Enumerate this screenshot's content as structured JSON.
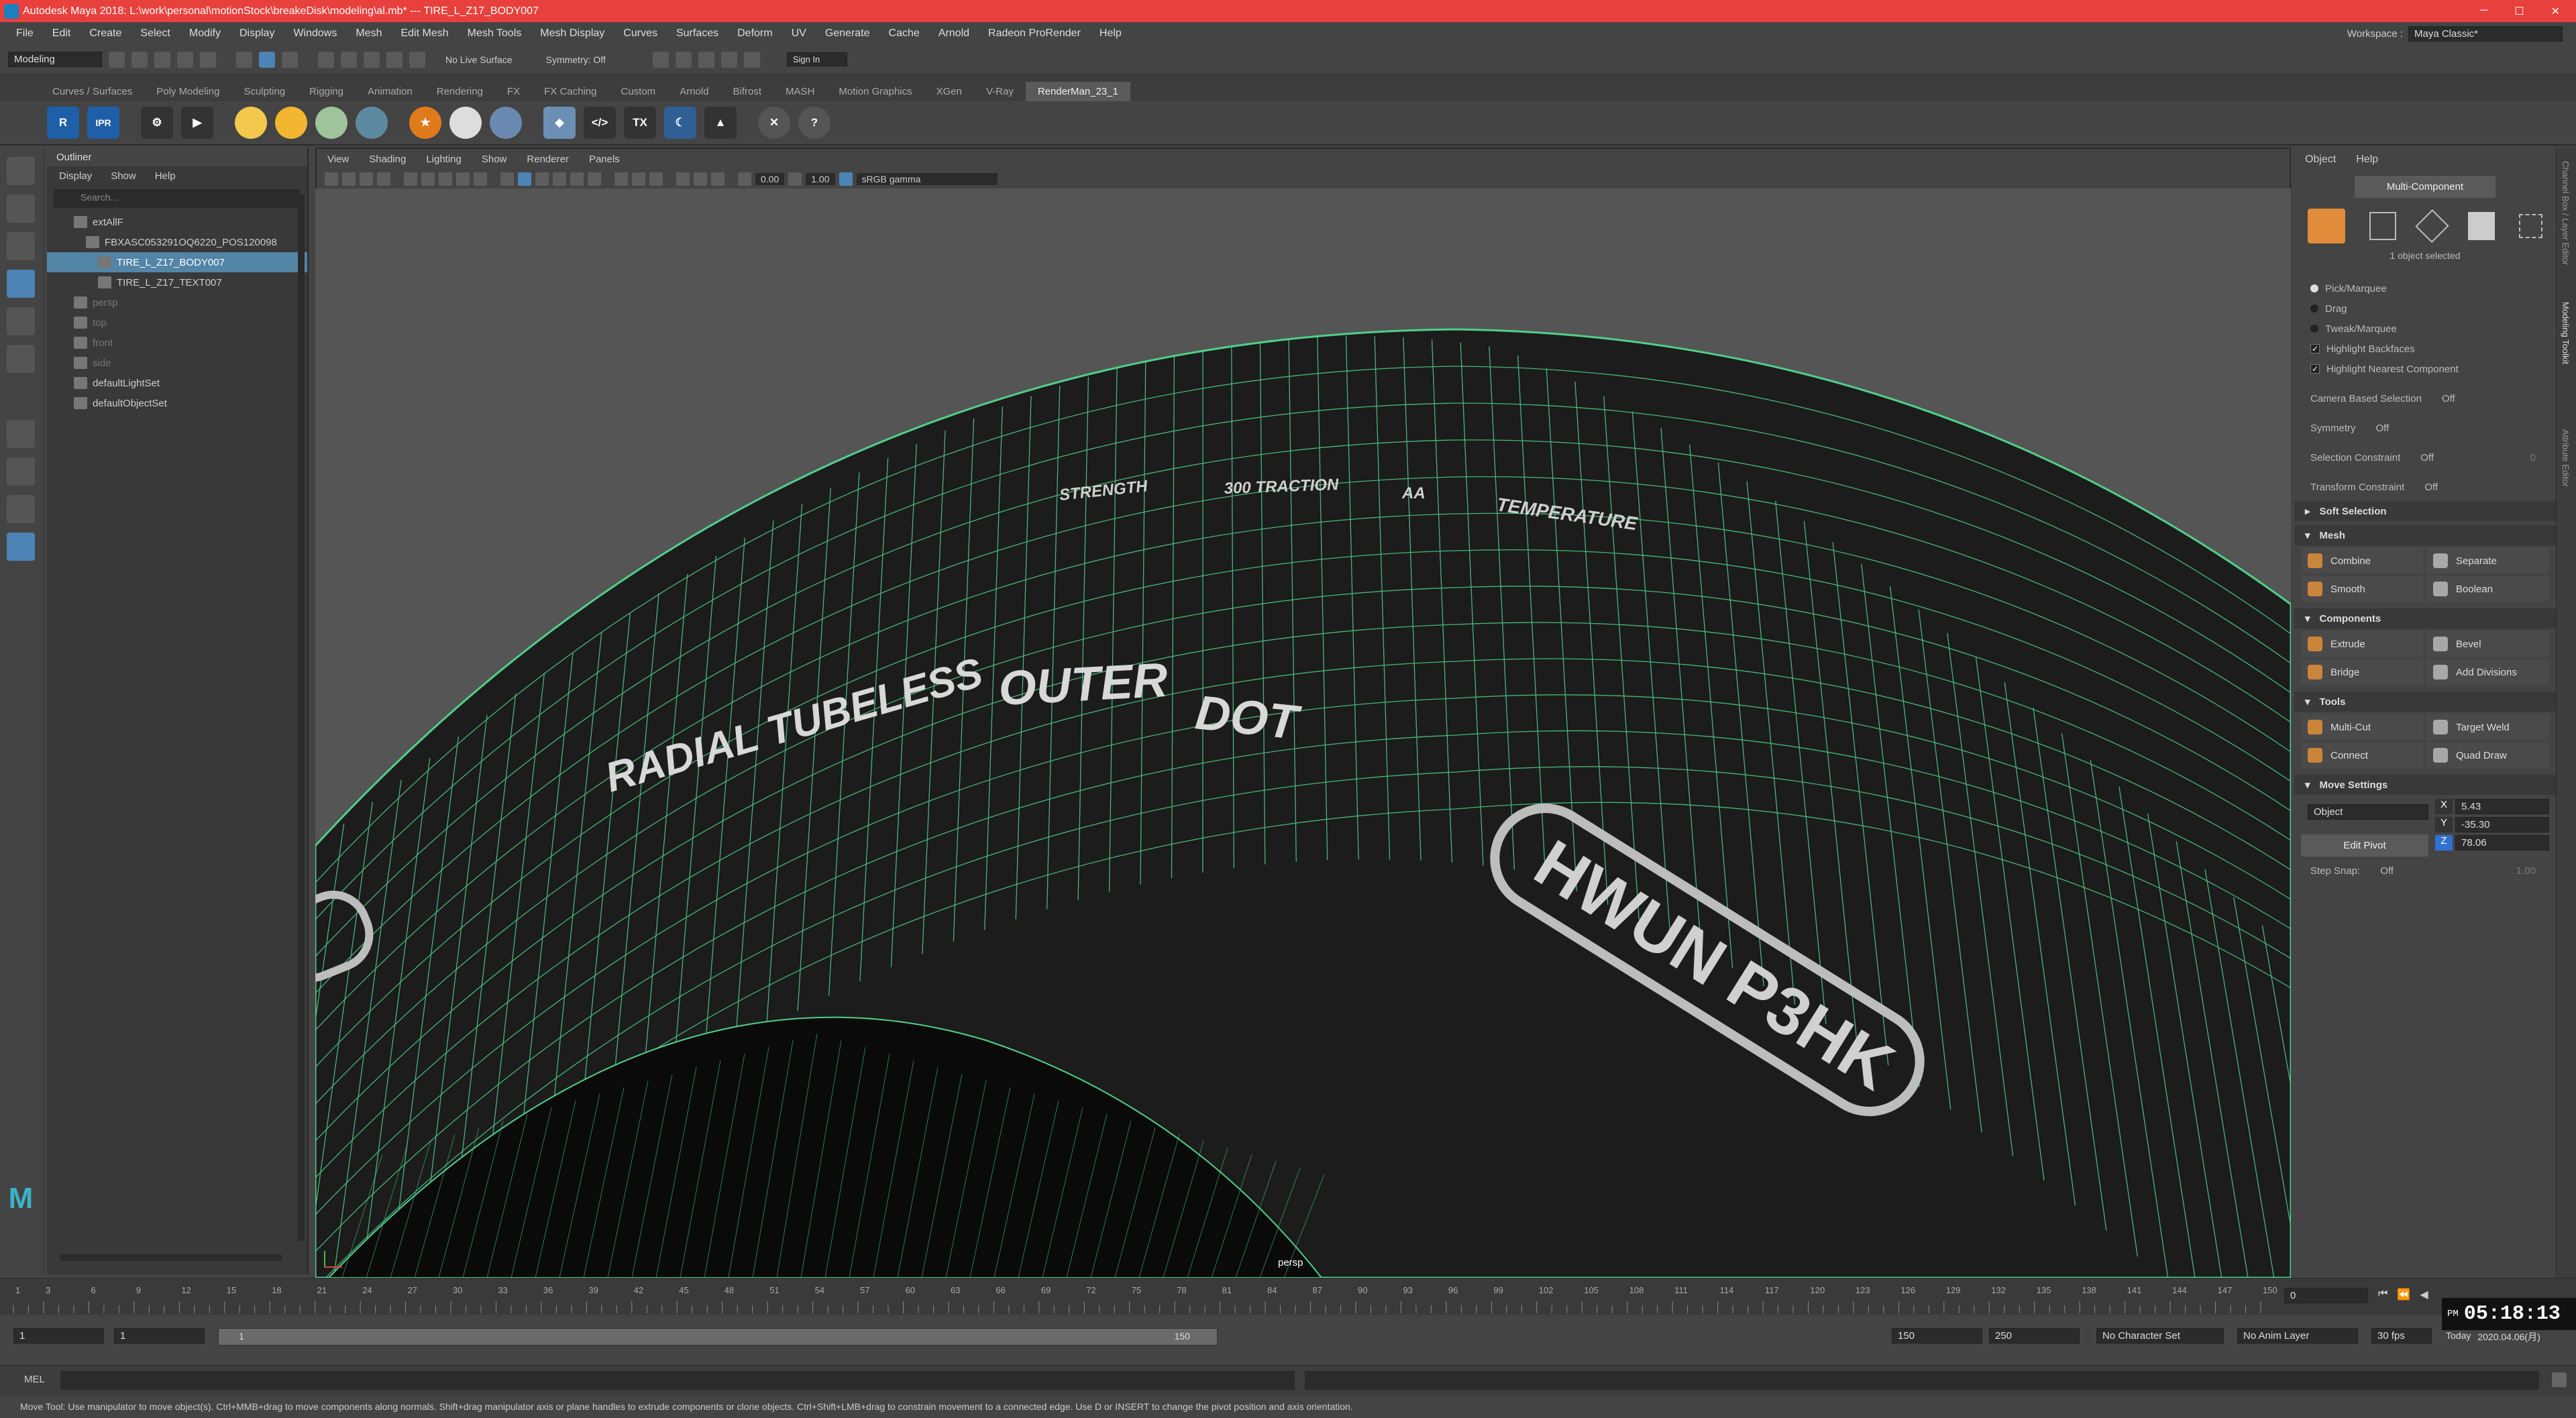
{
  "window": {
    "title": "Autodesk Maya 2018: L:\\work\\personal\\motionStock\\breakeDisk\\modeling\\al.mb* --- TIRE_L_Z17_BODY007"
  },
  "menu": [
    "File",
    "Edit",
    "Create",
    "Select",
    "Modify",
    "Display",
    "Windows",
    "Mesh",
    "Edit Mesh",
    "Mesh Tools",
    "Mesh Display",
    "Curves",
    "Surfaces",
    "Deform",
    "UV",
    "Generate",
    "Cache",
    "Arnold",
    "Radeon ProRender",
    "Help"
  ],
  "workspace": {
    "label": "Workspace :",
    "value": "Maya Classic*"
  },
  "status": {
    "mode": "Modeling",
    "live_surface": "No Live Surface",
    "symmetry": "Symmetry: Off",
    "sign_in": "Sign In"
  },
  "shelf_tabs": [
    "Curves / Surfaces",
    "Poly Modeling",
    "Sculpting",
    "Rigging",
    "Animation",
    "Rendering",
    "FX",
    "FX Caching",
    "Custom",
    "Arnold",
    "Bifrost",
    "MASH",
    "Motion Graphics",
    "XGen",
    "V-Ray",
    "RenderMan_23_1"
  ],
  "shelf_active_index": 15,
  "outliner": {
    "title": "Outliner",
    "menu": [
      "Display",
      "Show",
      "Help"
    ],
    "search_placeholder": "Search...",
    "items": [
      {
        "label": "extAllF",
        "indent": 0,
        "selected": false,
        "dim": false
      },
      {
        "label": "FBXASC053291OQ6220_POS120098",
        "indent": 1,
        "selected": false,
        "dim": false
      },
      {
        "label": "TIRE_L_Z17_BODY007",
        "indent": 2,
        "selected": true,
        "dim": false
      },
      {
        "label": "TIRE_L_Z17_TEXT007",
        "indent": 2,
        "selected": false,
        "dim": false
      },
      {
        "label": "persp",
        "indent": 0,
        "selected": false,
        "dim": true
      },
      {
        "label": "top",
        "indent": 0,
        "selected": false,
        "dim": true
      },
      {
        "label": "front",
        "indent": 0,
        "selected": false,
        "dim": true
      },
      {
        "label": "side",
        "indent": 0,
        "selected": false,
        "dim": true
      },
      {
        "label": "defaultLightSet",
        "indent": 0,
        "selected": false,
        "dim": false
      },
      {
        "label": "defaultObjectSet",
        "indent": 0,
        "selected": false,
        "dim": false
      }
    ]
  },
  "viewport": {
    "menu": [
      "View",
      "Shading",
      "Lighting",
      "Show",
      "Renderer",
      "Panels"
    ],
    "exposure": "0.00",
    "gamma": "1.00",
    "color_space": "sRGB gamma",
    "camera_label": "persp",
    "tire_texts": {
      "small1": "STRENGTH",
      "small2": "300 TRACTION",
      "small3": "AA",
      "small4": "TEMPERATURE",
      "large1": "RADIAL TUBELESS",
      "large2": "OUTER",
      "large3": "DOT",
      "badge": "HWUN P3HK"
    }
  },
  "modeling_toolkit": {
    "menu": [
      "Object",
      "Help"
    ],
    "mode_button": "Multi-Component",
    "selection_info": "1 object selected",
    "pick_options": [
      "Pick/Marquee",
      "Drag",
      "Tweak/Marquee"
    ],
    "checks": [
      "Highlight Backfaces",
      "Highlight Nearest Component"
    ],
    "camera_based_selection": {
      "label": "Camera Based Selection",
      "value": "Off"
    },
    "symmetry": {
      "label": "Symmetry",
      "value": "Off"
    },
    "selection_constraint": {
      "label": "Selection Constraint",
      "value": "Off",
      "num": "0"
    },
    "transform_constraint": {
      "label": "Transform Constraint",
      "value": "Off"
    },
    "sections": {
      "soft": "Soft Selection",
      "mesh": "Mesh",
      "components": "Components",
      "tools": "Tools",
      "move": "Move Settings"
    },
    "mesh_buttons": [
      "Combine",
      "Separate",
      "Smooth",
      "Boolean"
    ],
    "component_buttons": [
      "Extrude",
      "Bevel",
      "Bridge",
      "Add Divisions"
    ],
    "tool_buttons": [
      "Multi-Cut",
      "Target Weld",
      "Connect",
      "Quad Draw"
    ],
    "move": {
      "space": "Object",
      "x": "5.43",
      "y": "-35.30",
      "z": "78.06",
      "edit_pivot": "Edit Pivot",
      "step_snap_label": "Step Snap:",
      "step_snap_value": "Off",
      "step_snap_num": "1.00"
    }
  },
  "side_tabs": [
    "Channel Box / Layer Editor",
    "Modeling Toolkit",
    "Attribute Editor"
  ],
  "timeline": {
    "ticks": [
      "1",
      "3",
      "6",
      "9",
      "12",
      "15",
      "18",
      "21",
      "24",
      "27",
      "30",
      "33",
      "36",
      "39",
      "42",
      "45",
      "48",
      "51",
      "54",
      "57",
      "60",
      "63",
      "66",
      "69",
      "72",
      "75",
      "78",
      "81",
      "84",
      "87",
      "90",
      "93",
      "96",
      "99",
      "102",
      "105",
      "108",
      "111",
      "114",
      "117",
      "120",
      "123",
      "126",
      "129",
      "132",
      "135",
      "138",
      "141",
      "144",
      "147",
      "150"
    ],
    "current_frame": "0",
    "range_start": "1",
    "range_start2": "1",
    "range_slider_start": "1",
    "range_slider_end": "150",
    "playback_end": "150",
    "anim_end": "250",
    "character_set": "No Character Set",
    "anim_layer": "No Anim Layer",
    "fps": "30 fps"
  },
  "clock": {
    "ampm": "PM",
    "time": "05:18:13",
    "today": "Today",
    "date": "2020.04.06(月)"
  },
  "command": {
    "label": "MEL"
  },
  "help_line": "Move Tool: Use manipulator to move object(s). Ctrl+MMB+drag to move components along normals. Shift+drag manipulator axis or plane handles to extrude components or clone objects. Ctrl+Shift+LMB+drag to constrain movement to a connected edge. Use D or INSERT to change the pivot position and axis orientation.",
  "colors": {
    "title_bar": "#e8403c",
    "selection": "#5285a6",
    "wire": "#4fd08a",
    "active_tab": "#5a5a5a"
  }
}
